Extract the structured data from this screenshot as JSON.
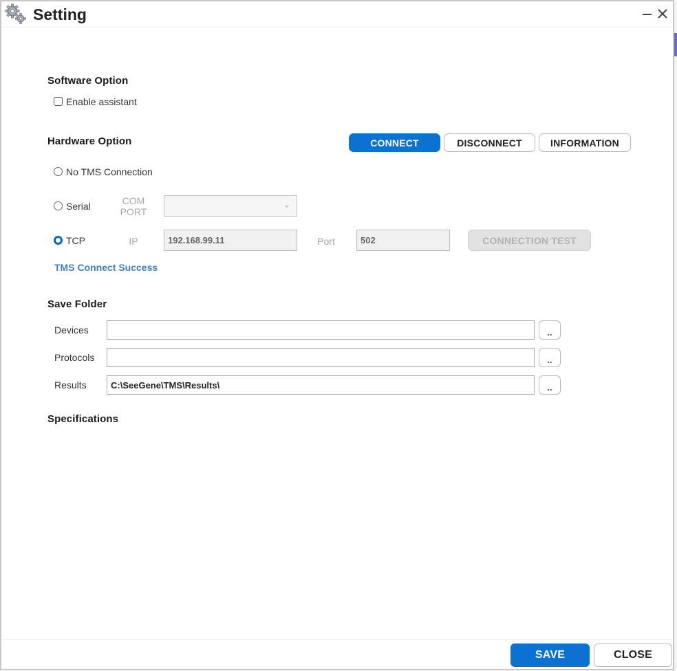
{
  "window": {
    "title": "Setting",
    "icons": {
      "title": "gears-icon",
      "minimize": "minimize-icon",
      "close": "close-icon"
    }
  },
  "software_option": {
    "title": "Software Option",
    "enable_assistant": {
      "label": "Enable assistant",
      "checked": false
    }
  },
  "hardware_option": {
    "title": "Hardware Option",
    "buttons": {
      "connect": "CONNECT",
      "disconnect": "DISCONNECT",
      "information": "INFORMATION"
    },
    "connection_modes": [
      {
        "label": "No TMS Connection",
        "selected": false
      },
      {
        "label": "Serial",
        "selected": false
      },
      {
        "label": "TCP",
        "selected": true
      }
    ],
    "serial": {
      "com_port_label_1": "COM",
      "com_port_label_2": "PORT",
      "com_port_value": ""
    },
    "tcp": {
      "ip_label": "IP",
      "ip_value": "192.168.99.11",
      "port_label": "Port",
      "port_value": "502",
      "connection_test": "CONNECTION TEST"
    },
    "status": {
      "text": "TMS Connect Success",
      "color": "#3f7fc0"
    }
  },
  "save_folder": {
    "title": "Save Folder",
    "rows": [
      {
        "label": "Devices",
        "value": "",
        "browse": ".."
      },
      {
        "label": "Protocols",
        "value": "",
        "browse": ".."
      },
      {
        "label": "Results",
        "value": "C:\\SeeGene\\TMS\\Results\\",
        "browse": ".."
      }
    ]
  },
  "specifications": {
    "title": "Specifications"
  },
  "footer": {
    "save": "SAVE",
    "close": "CLOSE"
  },
  "colors": {
    "primary": "#0b72d2",
    "selected_radio": "#0d63c1",
    "status_success": "#3f7fc0"
  }
}
